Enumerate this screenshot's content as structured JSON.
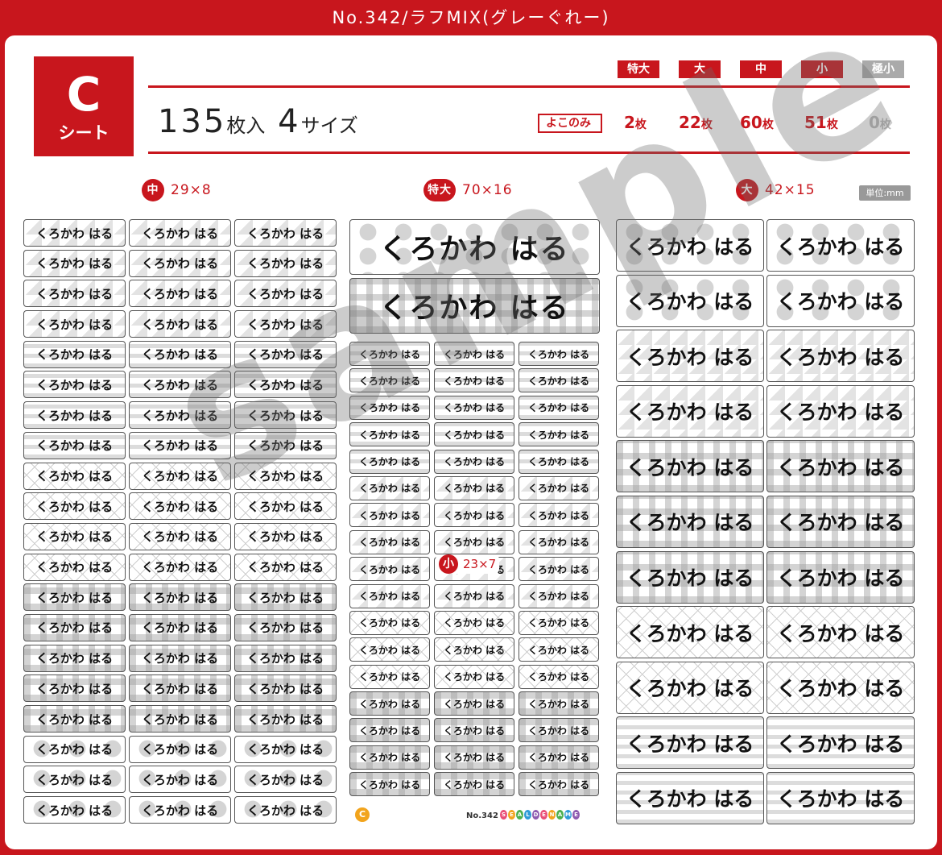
{
  "header": {
    "title": "No.342/ラフMIX(グレーぐれー)"
  },
  "sheet": {
    "letter": "C",
    "letter_sub": "シート"
  },
  "summary": {
    "count": "135",
    "count_unit": "枚入",
    "sizes": "4",
    "sizes_unit": "サイズ"
  },
  "size_tags": [
    {
      "label": "特大",
      "color": "#c8161d"
    },
    {
      "label": "大",
      "color": "#c8161d"
    },
    {
      "label": "中",
      "color": "#c8161d"
    },
    {
      "label": "小",
      "color": "#c8161d"
    },
    {
      "label": "極小",
      "color": "#aaaaaa"
    }
  ],
  "orientation_label": "よこのみ",
  "quantities": [
    {
      "value": "2",
      "unit": "枚"
    },
    {
      "value": "22",
      "unit": "枚"
    },
    {
      "value": "60",
      "unit": "枚"
    },
    {
      "value": "51",
      "unit": "枚"
    },
    {
      "value": "0",
      "unit": "枚"
    }
  ],
  "sections": {
    "medium": {
      "badge": "中",
      "dims": "29×8"
    },
    "xlarge": {
      "badge": "特大",
      "dims": "70×16"
    },
    "large": {
      "badge": "大",
      "dims": "42×15"
    },
    "small": {
      "badge": "小",
      "dims": "23×7"
    }
  },
  "unit_label": "単位:mm",
  "label_text": "くろかわ はる",
  "watermark": "sample",
  "footer": {
    "sheet_letter": "C",
    "product_no": "No.342",
    "brand_letters": [
      "S",
      "E",
      "A",
      "L",
      "D",
      "E",
      "N",
      "A",
      "M",
      "E"
    ]
  },
  "colors": {
    "brand_red": "#c8161d",
    "disabled_gray": "#aaaaaa"
  }
}
